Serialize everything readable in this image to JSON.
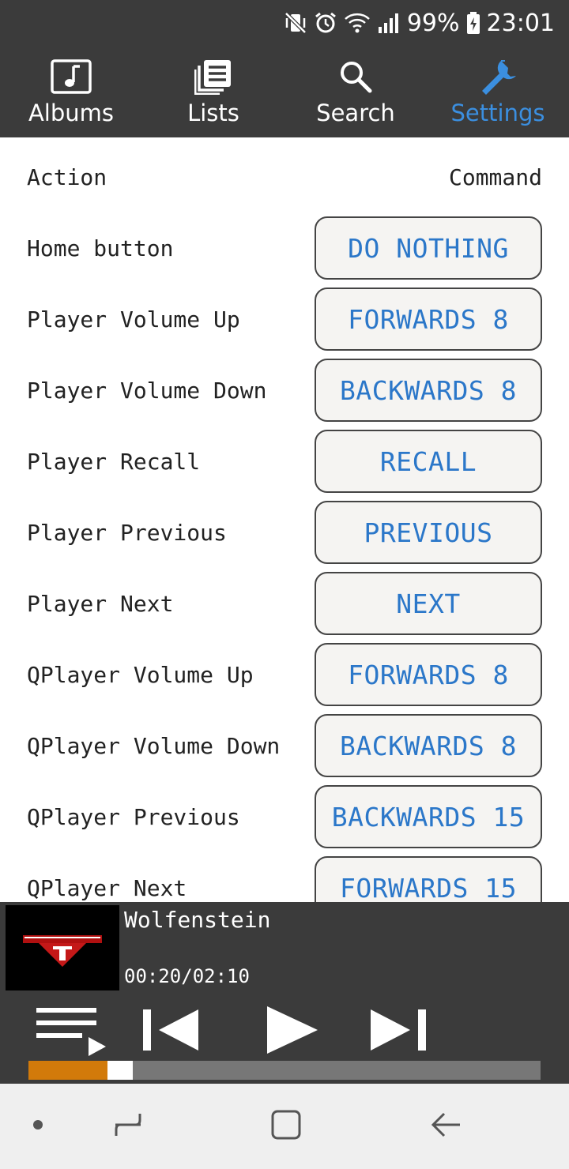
{
  "status_bar": {
    "battery": "99%",
    "time": "23:01",
    "icons": [
      "mute-vibrate-icon",
      "alarm-icon",
      "wifi-icon",
      "signal-icon",
      "battery-charging-icon"
    ]
  },
  "tabs": [
    {
      "label": "Albums",
      "icon": "music-note-icon",
      "active": false
    },
    {
      "label": "Lists",
      "icon": "list-icon",
      "active": false
    },
    {
      "label": "Search",
      "icon": "search-icon",
      "active": false
    },
    {
      "label": "Settings",
      "icon": "wrench-icon",
      "active": true
    }
  ],
  "settings": {
    "header_action": "Action",
    "header_command": "Command",
    "rows": [
      {
        "action": "Home button",
        "command": "DO NOTHING"
      },
      {
        "action": "Player Volume Up",
        "command": "FORWARDS 8"
      },
      {
        "action": "Player Volume Down",
        "command": "BACKWARDS 8"
      },
      {
        "action": "Player Recall",
        "command": "RECALL"
      },
      {
        "action": "Player Previous",
        "command": "PREVIOUS"
      },
      {
        "action": "Player Next",
        "command": "NEXT"
      },
      {
        "action": "QPlayer Volume Up",
        "command": "FORWARDS 8"
      },
      {
        "action": "QPlayer Volume Down",
        "command": "BACKWARDS 8"
      },
      {
        "action": "QPlayer Previous",
        "command": "BACKWARDS 15"
      },
      {
        "action": "QPlayer Next",
        "command": "FORWARDS 15"
      }
    ]
  },
  "player": {
    "title": "Wolfenstein",
    "time": "00:20/02:10",
    "progress_fraction": 0.154,
    "colors": {
      "progress": "#d27a0a",
      "track": "#777777"
    }
  },
  "accent_color": "#3b8fe0"
}
